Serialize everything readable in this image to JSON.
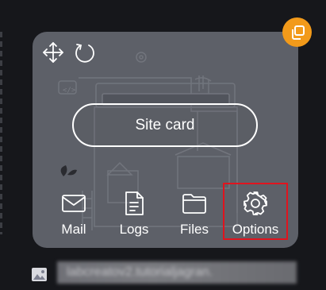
{
  "card": {
    "main_button_label": "Site card",
    "actions": [
      {
        "label": "Mail"
      },
      {
        "label": "Logs"
      },
      {
        "label": "Files"
      },
      {
        "label": "Options"
      }
    ]
  },
  "footer": {
    "url": "labcreatov2.tutorialjagran."
  },
  "colors": {
    "accent": "#f29a1a",
    "highlight": "#e0141e",
    "card_bg": "#5d6068",
    "page_bg": "#16171b"
  }
}
